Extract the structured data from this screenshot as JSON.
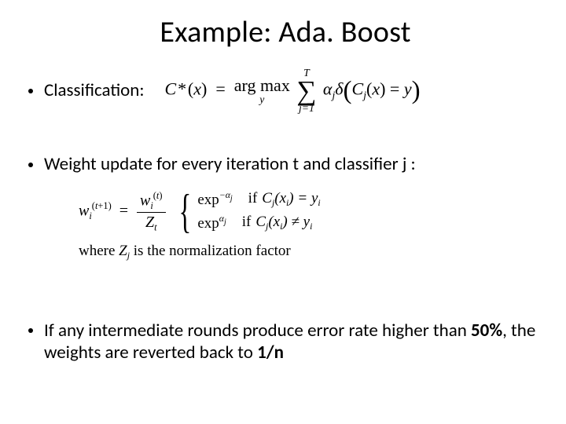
{
  "title": "Example: Ada. Boost",
  "bullets": {
    "classification_label": "Classification:",
    "weight_update_label": "Weight update for every iteration t and classifier j :",
    "error_rule_pre": "If any intermediate rounds produce error rate higher than ",
    "error_rule_pct": "50%",
    "error_rule_mid": ", the weights are reverted back to ",
    "error_rule_rev": "1/n"
  },
  "formulas": {
    "classification": {
      "lhs_C": "C",
      "lhs_star": "*",
      "lhs_x": "x",
      "eq": "=",
      "argmax": "arg max",
      "argmax_sub": "y",
      "sum_top": "T",
      "sum_bottom": "j=1",
      "alpha": "α",
      "alpha_sub": "j",
      "delta": "δ",
      "inner_C": "C",
      "inner_C_sub": "j",
      "inner_x": "x",
      "cmp": "=",
      "rhs_y": "y"
    },
    "weight": {
      "lhs_w": "w",
      "lhs_i": "i",
      "lhs_sup": "(t+1)",
      "eq": "=",
      "num_w": "w",
      "num_i": "i",
      "num_sup": "(t)",
      "den_Z": "Z",
      "den_t": "t",
      "exp": "exp",
      "exp_neg": "−α",
      "exp_neg_sub": "j",
      "exp_pos": "α",
      "exp_pos_sub": "j",
      "if_word": "if",
      "cond_C": "C",
      "cond_C_sub": "j",
      "cond_x": "x",
      "cond_x_sub": "i",
      "eq_sym": "=",
      "neq_sym": "≠",
      "cond_y": "y",
      "cond_y_sub": "i",
      "where_pre": "where ",
      "where_Z": "Z",
      "where_Z_sub": "j",
      "where_post": " is the normalization factor"
    }
  }
}
